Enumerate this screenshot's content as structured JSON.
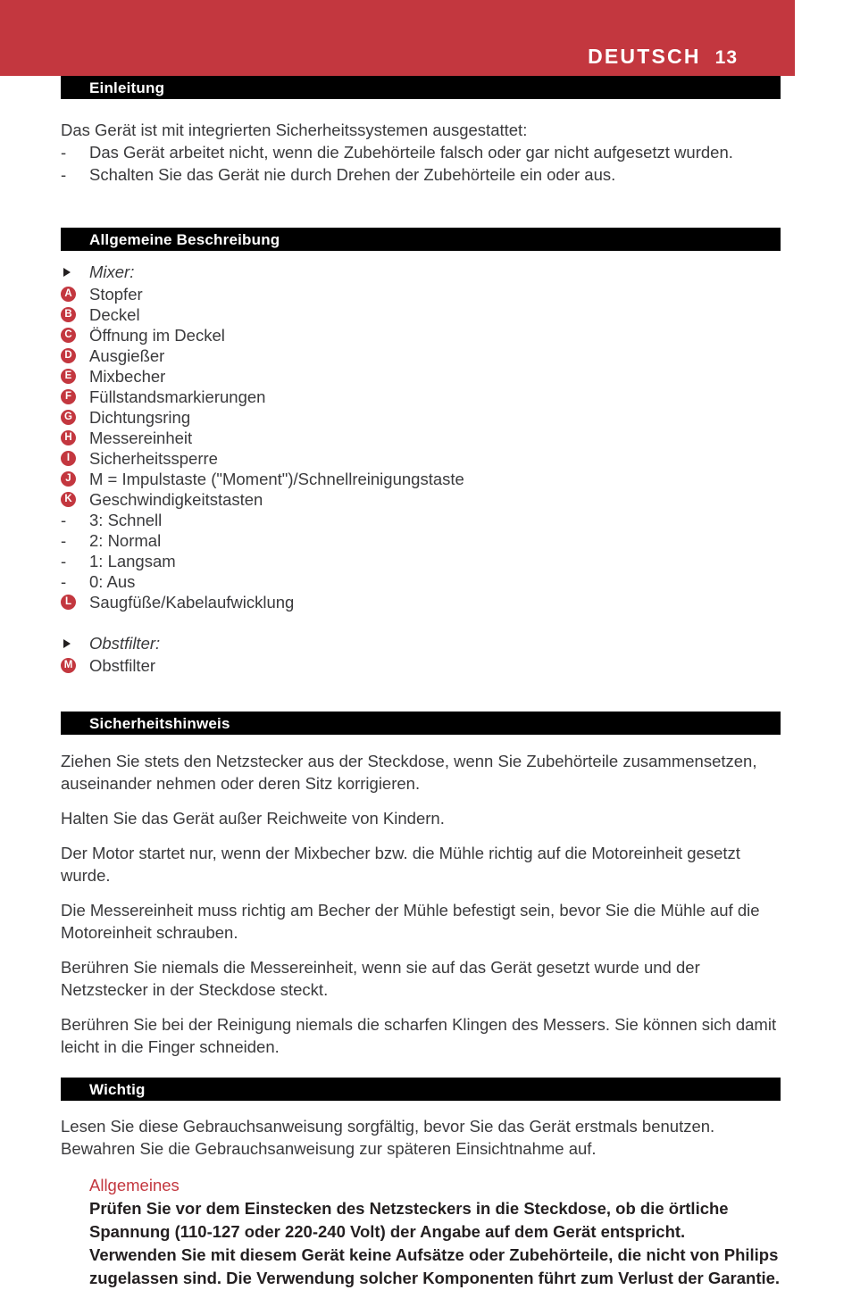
{
  "header": {
    "language": "DEUTSCH",
    "page_number": "13",
    "banner_color": "#c3373f"
  },
  "theme": {
    "accent_red": "#c3373f",
    "bar_black": "#000000",
    "body_text": "#3a3a3c"
  },
  "sections": {
    "einleitung": {
      "title": "Einleitung",
      "lead": "Das Gerät ist mit integrierten Sicherheitssystemen ausgestattet:",
      "items": [
        {
          "marker": "-",
          "text": "Das Gerät arbeitet nicht, wenn die Zubehörteile falsch oder gar nicht aufgesetzt wurden."
        },
        {
          "marker": "-",
          "text": "Schalten Sie das Gerät nie durch Drehen der Zubehörteile ein oder aus."
        }
      ]
    },
    "allgemeine_beschreibung": {
      "title": "Allgemeine Beschreibung",
      "rows": [
        {
          "type": "group",
          "marker": "triangle-bullet",
          "text": "Mixer:"
        },
        {
          "type": "letter",
          "marker": "A",
          "text": "Stopfer"
        },
        {
          "type": "letter",
          "marker": "B",
          "text": "Deckel"
        },
        {
          "type": "letter",
          "marker": "C",
          "text": "Öffnung im Deckel"
        },
        {
          "type": "letter",
          "marker": "D",
          "text": "Ausgießer"
        },
        {
          "type": "letter",
          "marker": "E",
          "text": "Mixbecher"
        },
        {
          "type": "letter",
          "marker": "F",
          "text": "Füllstandsmarkierungen"
        },
        {
          "type": "letter",
          "marker": "G",
          "text": "Dichtungsring"
        },
        {
          "type": "letter",
          "marker": "H",
          "text": "Messereinheit"
        },
        {
          "type": "letter",
          "marker": "I",
          "text": "Sicherheitssperre"
        },
        {
          "type": "letter",
          "marker": "J",
          "text": "M = Impulstaste (\"Moment\")/Schnellreinigungstaste"
        },
        {
          "type": "letter",
          "marker": "K",
          "text": "Geschwindigkeitstasten"
        },
        {
          "type": "dash",
          "marker": "-",
          "text": "3: Schnell"
        },
        {
          "type": "dash",
          "marker": "-",
          "text": "2: Normal"
        },
        {
          "type": "dash",
          "marker": "-",
          "text": "1: Langsam"
        },
        {
          "type": "dash",
          "marker": "-",
          "text": "0: Aus"
        },
        {
          "type": "letter",
          "marker": "L",
          "text": "Saugfüße/Kabelaufwicklung"
        },
        {
          "type": "spacer",
          "marker": "",
          "text": ""
        },
        {
          "type": "group",
          "marker": "triangle-bullet",
          "text": "Obstfilter:"
        },
        {
          "type": "letter",
          "marker": "M",
          "text": "Obstfilter"
        }
      ]
    },
    "sicherheitshinweis": {
      "title": "Sicherheitshinweis",
      "paragraphs": [
        "Ziehen Sie stets den Netzstecker aus der Steckdose, wenn Sie Zubehörteile zusammensetzen, auseinander nehmen oder deren Sitz korrigieren.",
        "Halten Sie das Gerät außer Reichweite von Kindern.",
        "Der Motor startet nur, wenn der Mixbecher bzw. die Mühle richtig auf die Motoreinheit gesetzt wurde.",
        "Die Messereinheit muss richtig am Becher der Mühle befestigt sein, bevor Sie die Mühle auf die Motoreinheit schrauben.",
        "Berühren Sie niemals die Messereinheit, wenn sie auf das Gerät gesetzt wurde und der Netzstecker in der Steckdose steckt.",
        "Berühren Sie bei der Reinigung niemals die scharfen Klingen des Messers. Sie können sich damit leicht in die Finger schneiden."
      ]
    },
    "wichtig": {
      "title": "Wichtig",
      "lead": "Lesen Sie diese Gebrauchsanweisung sorgfältig, bevor Sie das Gerät erstmals benutzen. Bewahren Sie die Gebrauchsanweisung zur späteren Einsichtnahme auf.",
      "sub_heading": "Allgemeines",
      "sub_paragraphs": [
        "Prüfen Sie vor dem Einstecken des Netzsteckers in die Steckdose, ob die örtliche Spannung (110-127 oder 220-240 Volt) der Angabe auf dem Gerät entspricht.",
        "Verwenden Sie mit diesem Gerät keine Aufsätze oder Zubehörteile, die nicht von Philips zugelassen sind. Die Verwendung solcher Komponenten führt zum Verlust der Garantie."
      ]
    }
  }
}
